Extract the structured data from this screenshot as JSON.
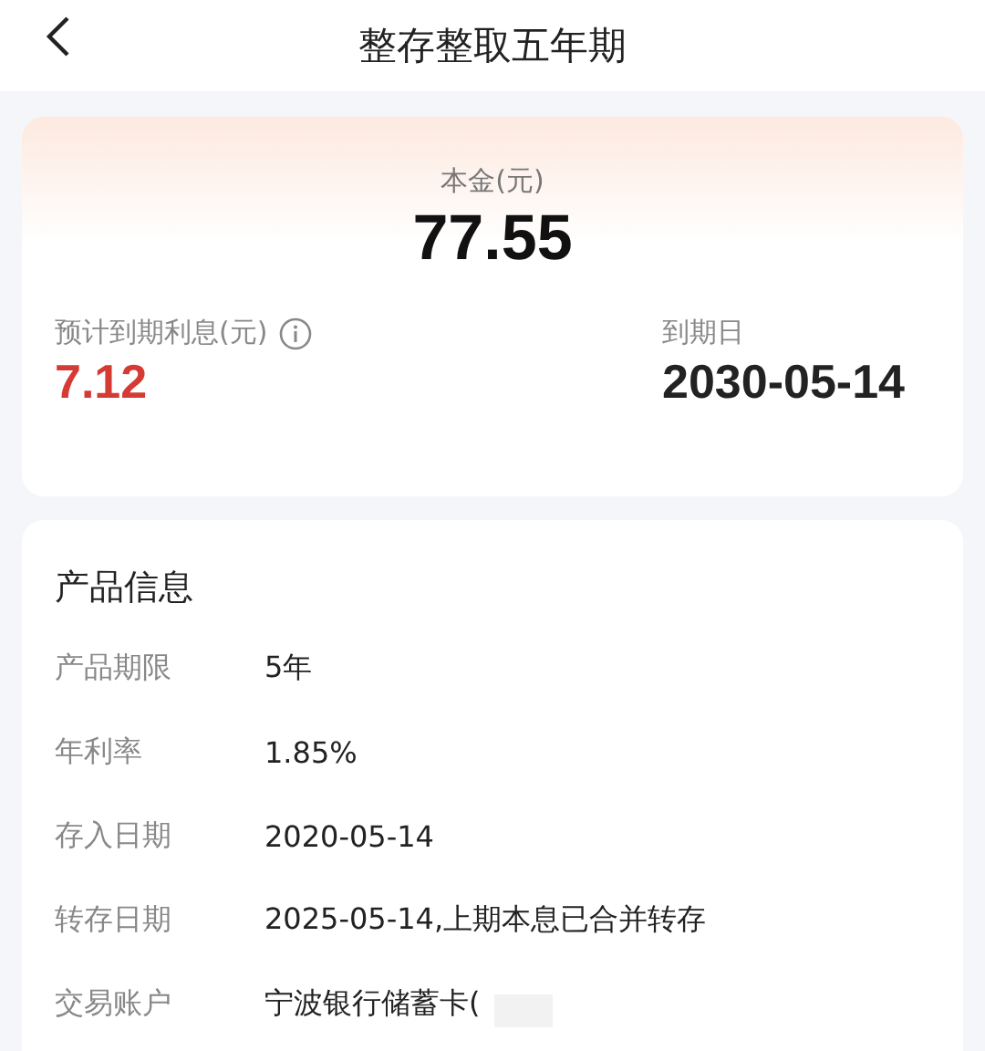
{
  "header": {
    "title": "整存整取五年期"
  },
  "summary": {
    "principal_label": "本金(元)",
    "principal": "77.55",
    "interest_label": "预计到期利息(元)",
    "interest": "7.12",
    "maturity_label": "到期日",
    "maturity": "2030-05-14"
  },
  "product_info": {
    "title": "产品信息",
    "rows": [
      {
        "label": "产品期限",
        "value": "5年"
      },
      {
        "label": "年利率",
        "value": "1.85%"
      },
      {
        "label": "存入日期",
        "value": "2020-05-14"
      },
      {
        "label": "转存日期",
        "value": "2025-05-14,上期本息已合并转存"
      },
      {
        "label": "交易账户",
        "value": "宁波银行储蓄卡(",
        "redacted": true
      }
    ]
  }
}
